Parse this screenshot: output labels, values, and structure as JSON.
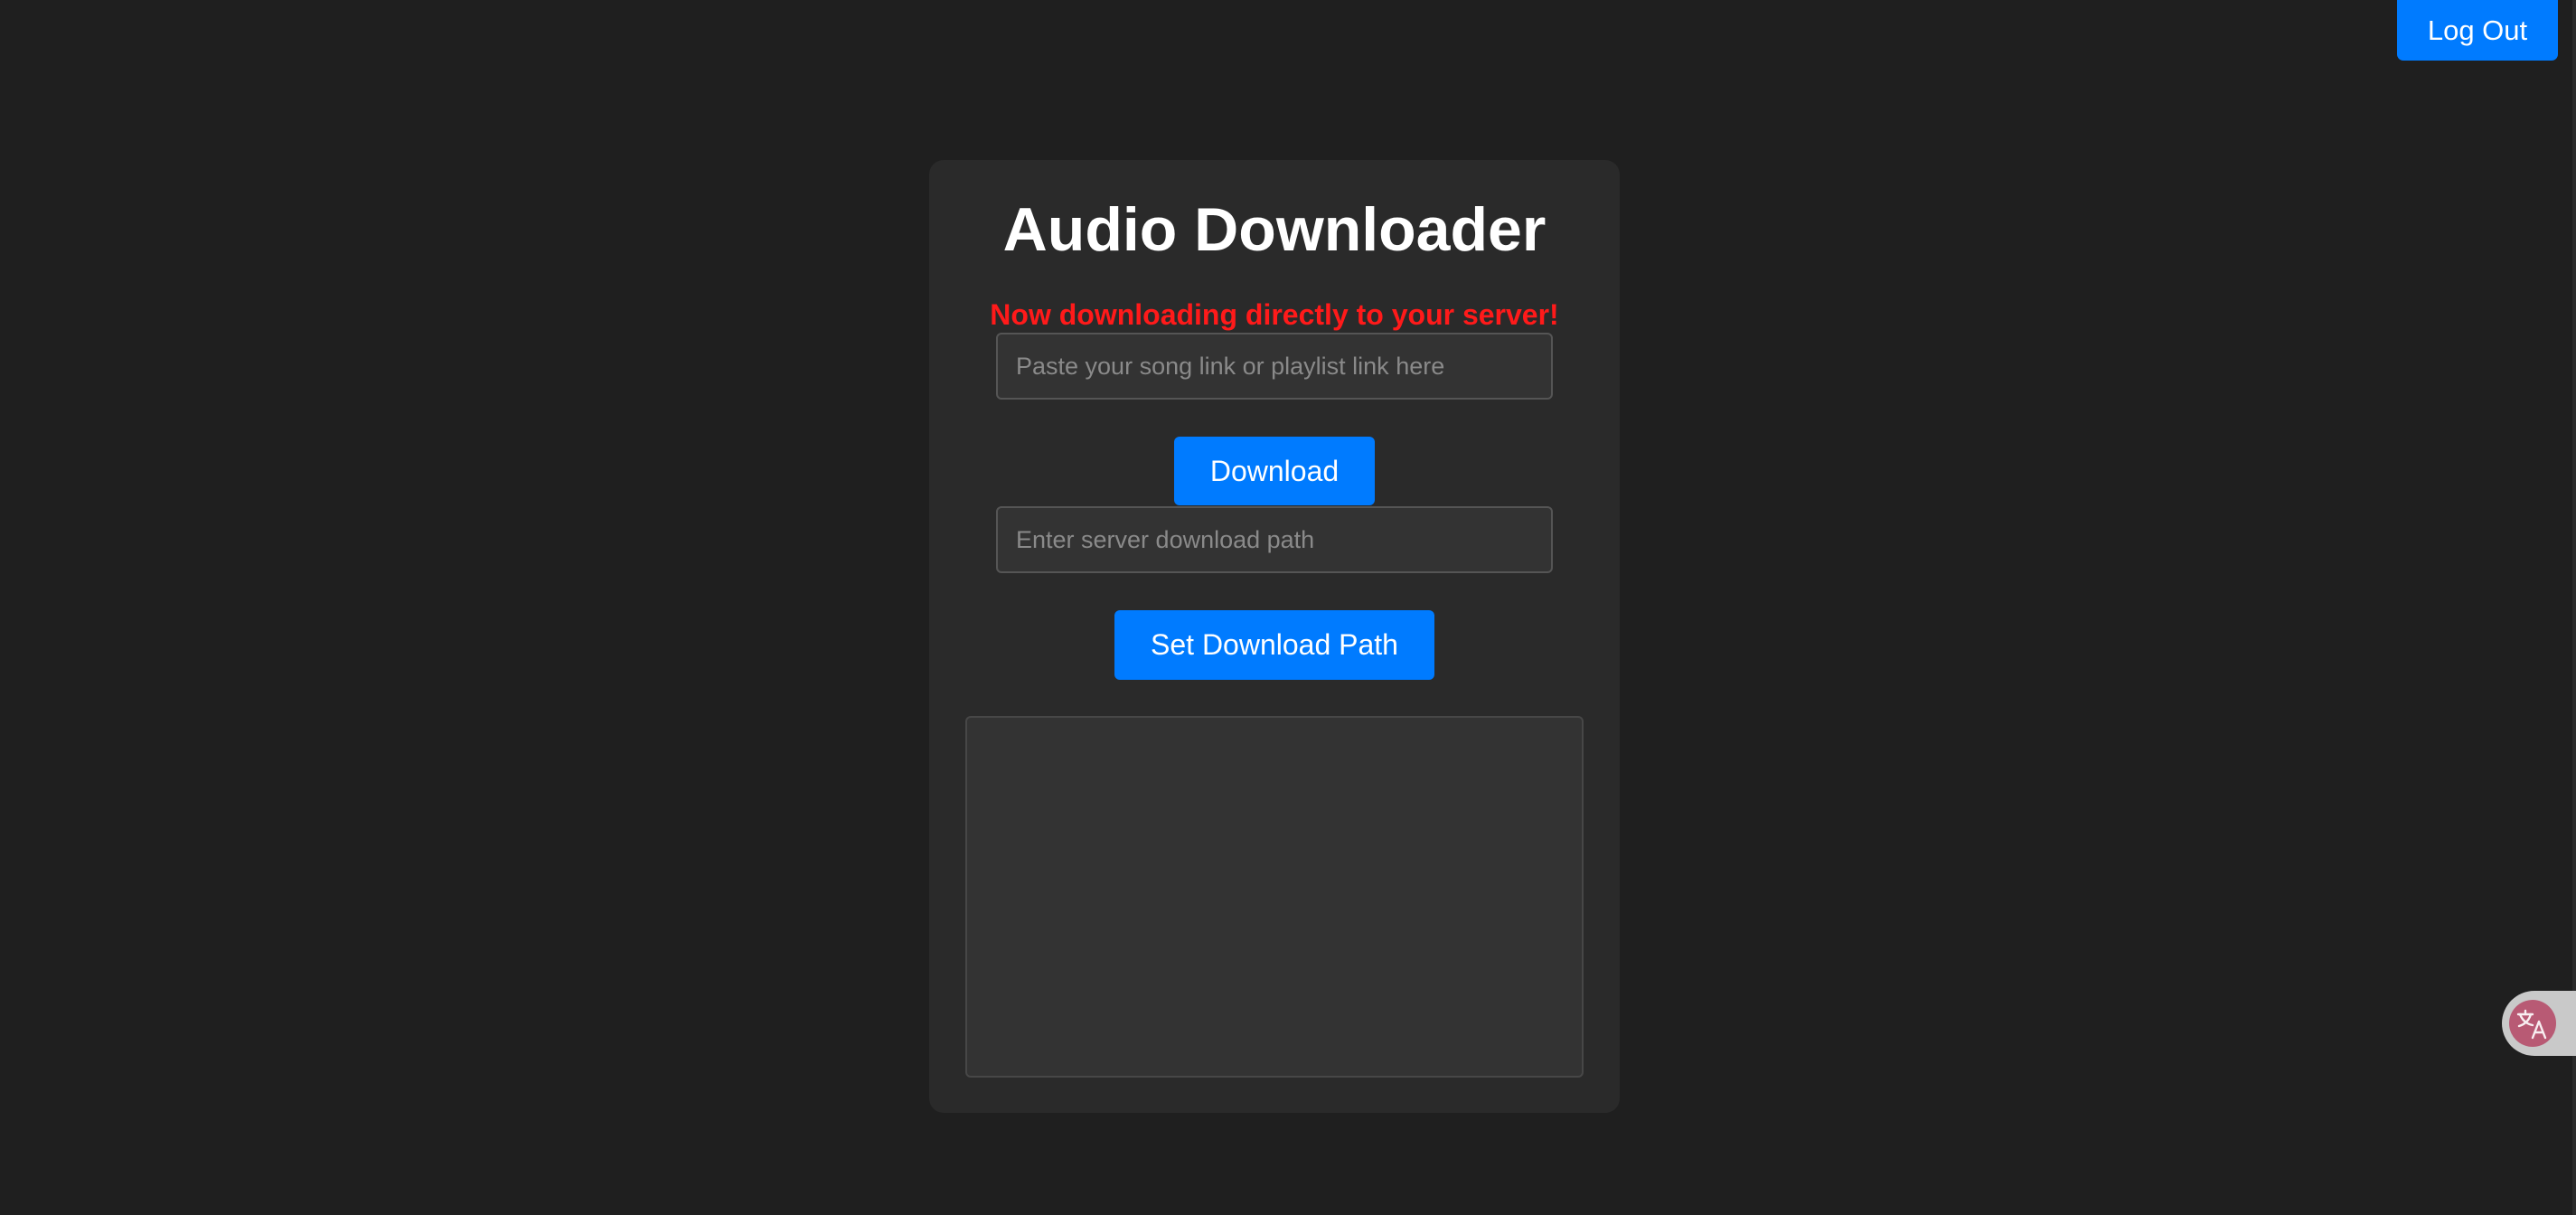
{
  "header": {
    "logout_label": "Log Out"
  },
  "card": {
    "title": "Audio Downloader",
    "notice": "Now downloading directly to your server!",
    "link_input": {
      "placeholder": "Paste your song link or playlist link here",
      "value": ""
    },
    "download_label": "Download",
    "path_input": {
      "placeholder": "Enter server download path",
      "value": ""
    },
    "set_path_label": "Set Download Path",
    "output": {
      "value": ""
    }
  },
  "widgets": {
    "translate_icon": "translate-icon"
  },
  "colors": {
    "background": "#1f1f1f",
    "card": "#2a2a2a",
    "accent": "#007bff",
    "notice": "#ff1a1a",
    "input_bg": "#333333",
    "translate_badge": "#b85a74"
  }
}
